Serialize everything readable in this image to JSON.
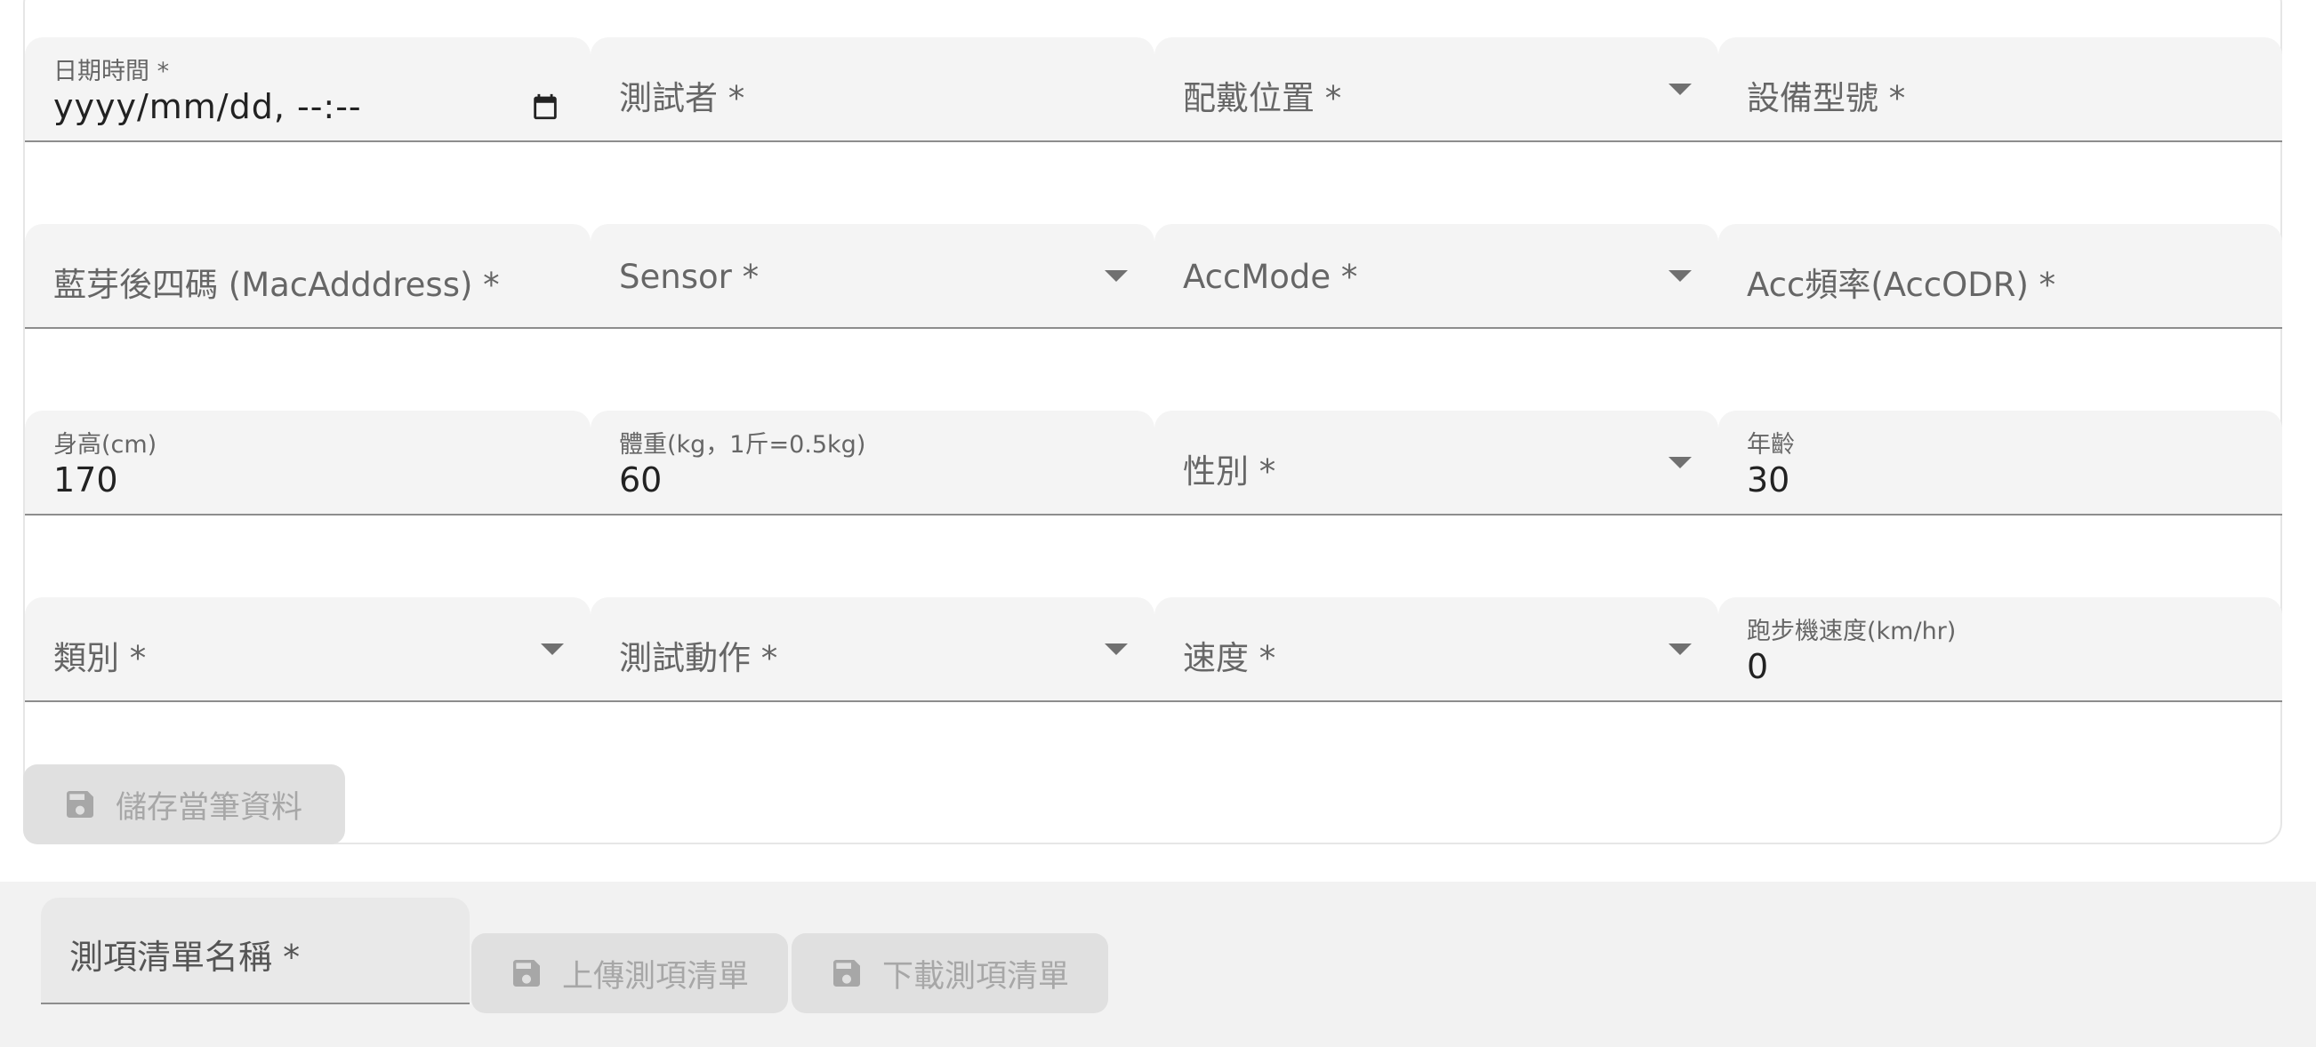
{
  "form": {
    "datetime": {
      "label": "日期時間 *",
      "value": "yyyy/mm/dd, --:--"
    },
    "tester": {
      "label": "測試者 *"
    },
    "wear_position": {
      "label": "配戴位置 *"
    },
    "device_model": {
      "label": "設備型號 *"
    },
    "mac_address": {
      "label": "藍芽後四碼 (MacAdddress) *"
    },
    "sensor": {
      "label": "Sensor *"
    },
    "acc_mode": {
      "label": "AccMode *"
    },
    "acc_odr": {
      "label": "Acc頻率(AccODR) *"
    },
    "height": {
      "label": "身高(cm)",
      "value": "170"
    },
    "weight": {
      "label": "體重(kg，1斤=0.5kg)",
      "value": "60"
    },
    "gender": {
      "label": "性別 *"
    },
    "age": {
      "label": "年齡",
      "value": "30"
    },
    "category": {
      "label": "類別 *"
    },
    "test_action": {
      "label": "測試動作 *"
    },
    "speed": {
      "label": "速度 *"
    },
    "treadmill_speed": {
      "label": "跑步機速度(km/hr)",
      "value": "0"
    },
    "save_button": {
      "label": "儲存當筆資料",
      "icon": "save-icon"
    }
  },
  "bottom": {
    "list_name": {
      "label": "測項清單名稱 *"
    },
    "upload_button": {
      "label": "上傳測項清單",
      "icon": "save-icon"
    },
    "download_button": {
      "label": "下載測項清單",
      "icon": "save-icon"
    }
  },
  "colors": {
    "field_bg": "#f4f4f4",
    "underline": "#8d8d8d",
    "disabled_button_bg": "#e0e0e0",
    "disabled_text": "#a7a7a7",
    "footer_bg": "#f2f2f2"
  }
}
